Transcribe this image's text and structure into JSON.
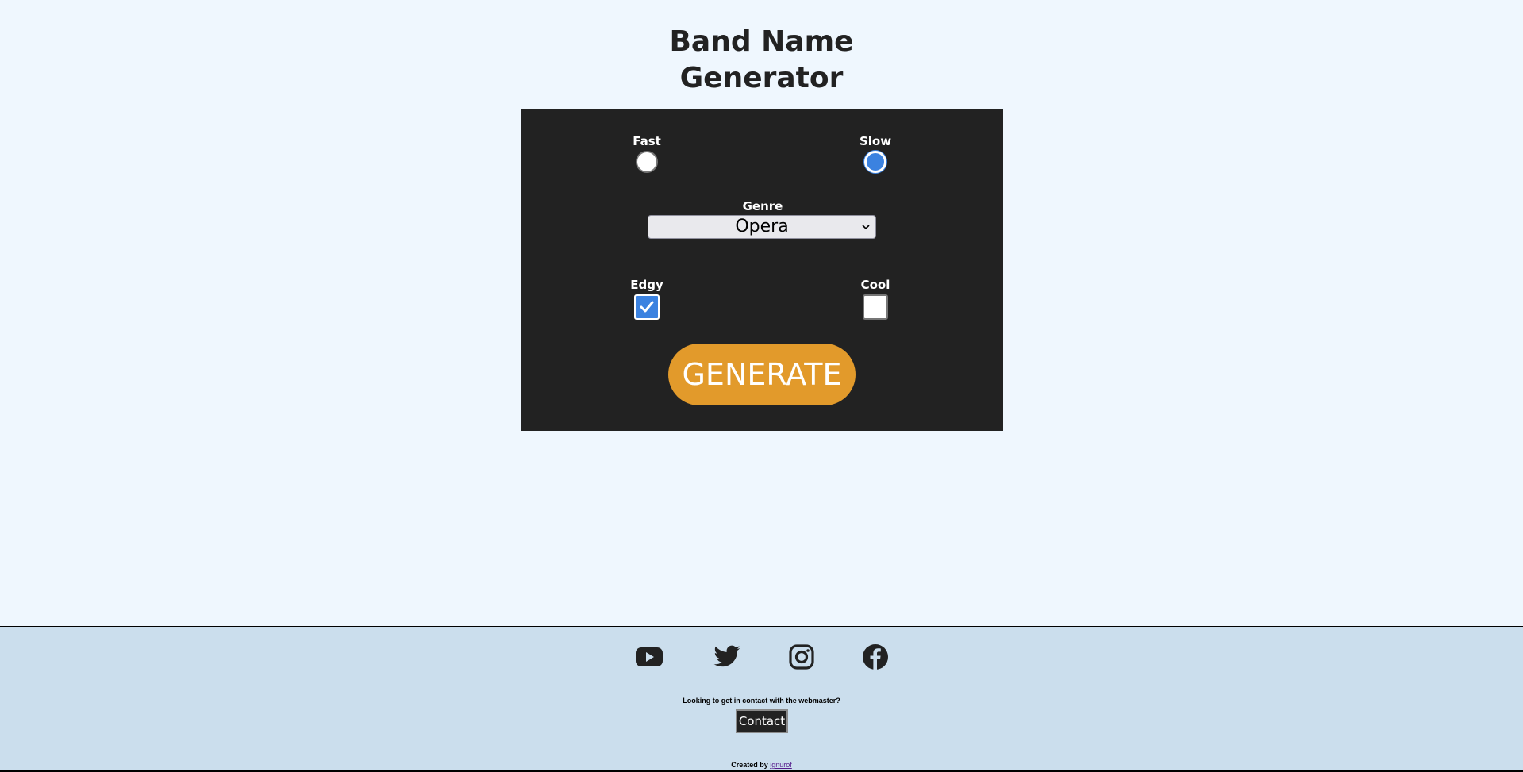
{
  "header": {
    "title_line1": "Band Name",
    "title_line2": "Generator"
  },
  "form": {
    "speed": {
      "options": [
        {
          "label": "Fast",
          "checked": false
        },
        {
          "label": "Slow",
          "checked": true
        }
      ]
    },
    "genre": {
      "label": "Genre",
      "selected": "Opera"
    },
    "attributes": {
      "options": [
        {
          "label": "Edgy",
          "checked": true
        },
        {
          "label": "Cool",
          "checked": false
        }
      ]
    },
    "generate_label": "GENERATE"
  },
  "colors": {
    "page_background": "#eff7fe",
    "panel_background": "#222222",
    "accent": "#3b82e0",
    "generate_button": "#e29a2b",
    "footer_background": "#cbdeed"
  },
  "footer": {
    "social_icons": [
      "youtube-icon",
      "twitter-icon",
      "instagram-icon",
      "facebook-icon"
    ],
    "contact_prompt": "Looking to get in contact with the webmaster?",
    "contact_label": "Contact",
    "credit_prefix": "Created by",
    "credit_author": "ignurof"
  }
}
